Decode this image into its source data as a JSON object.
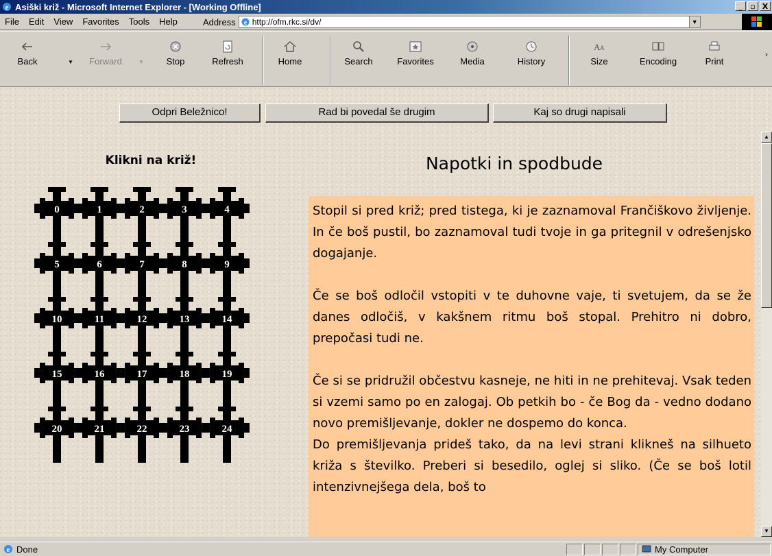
{
  "window": {
    "title": "Asiški križ - Microsoft Internet Explorer - [Working Offline]",
    "minimize": "_",
    "maximize": "▫",
    "close": "X"
  },
  "menu": [
    "File",
    "Edit",
    "View",
    "Favorites",
    "Tools",
    "Help"
  ],
  "address": {
    "label": "Address",
    "url": "http://ofm.rkc.si/dv/"
  },
  "toolbar": [
    {
      "label": "Back",
      "icon": "back-arrow-icon",
      "enabled": true
    },
    {
      "label": "Forward",
      "icon": "forward-arrow-icon",
      "enabled": false
    },
    {
      "label": "Stop",
      "icon": "stop-icon",
      "enabled": true
    },
    {
      "label": "Refresh",
      "icon": "refresh-icon",
      "enabled": true
    },
    {
      "label": "Home",
      "icon": "home-icon",
      "enabled": true
    },
    {
      "label": "Search",
      "icon": "search-icon",
      "enabled": true
    },
    {
      "label": "Favorites",
      "icon": "favorites-icon",
      "enabled": true
    },
    {
      "label": "Media",
      "icon": "media-icon",
      "enabled": true
    },
    {
      "label": "History",
      "icon": "history-icon",
      "enabled": true
    },
    {
      "label": "Size",
      "icon": "text-size-icon",
      "enabled": true
    },
    {
      "label": "Encoding",
      "icon": "encoding-icon",
      "enabled": true
    },
    {
      "label": "Print",
      "icon": "print-icon",
      "enabled": true
    }
  ],
  "page": {
    "buttons": [
      "Odpri Beležnico!",
      "Rad bi povedal še drugim",
      "Kaj so drugi napisali"
    ],
    "klikni": "Klikni na križ!",
    "heading": "Napotki in spodbude",
    "crosses": [
      "0",
      "1",
      "2",
      "3",
      "4",
      "5",
      "6",
      "7",
      "8",
      "9",
      "10",
      "11",
      "12",
      "13",
      "14",
      "15",
      "16",
      "17",
      "18",
      "19",
      "20",
      "21",
      "22",
      "23",
      "24"
    ],
    "paragraphs": [
      "Stopil si pred križ; pred tistega, ki je zaznamoval Frančiškovo življenje. In če boš pustil, bo zaznamoval tudi tvoje in ga pritegnil v odrešenjsko dogajanje.",
      "Če se boš odločil vstopiti v te duhovne vaje, ti svetujem, da se že danes odločiš, v kakšnem ritmu boš stopal. Prehitro ni dobro, prepočasi tudi ne.",
      "Če si se pridružil občestvu kasneje, ne hiti in ne prehitevaj. Vsak teden si vzemi samo po en zalogaj. Ob petkih bo - če Bog da - vedno dodano novo premišljevanje, dokler ne dospemo do konca.",
      "Do premišljevanja prideš tako, da na levi strani klikneš na silhueto križa s številko. Preberi si besedilo, oglej si sliko. (Če se boš lotil intenzivnejšega dela, boš to"
    ],
    "colors": {
      "textbox": "#ffcc99",
      "background": "#e6ddd1"
    }
  },
  "status": {
    "text": "Done",
    "zone": "My Computer"
  }
}
